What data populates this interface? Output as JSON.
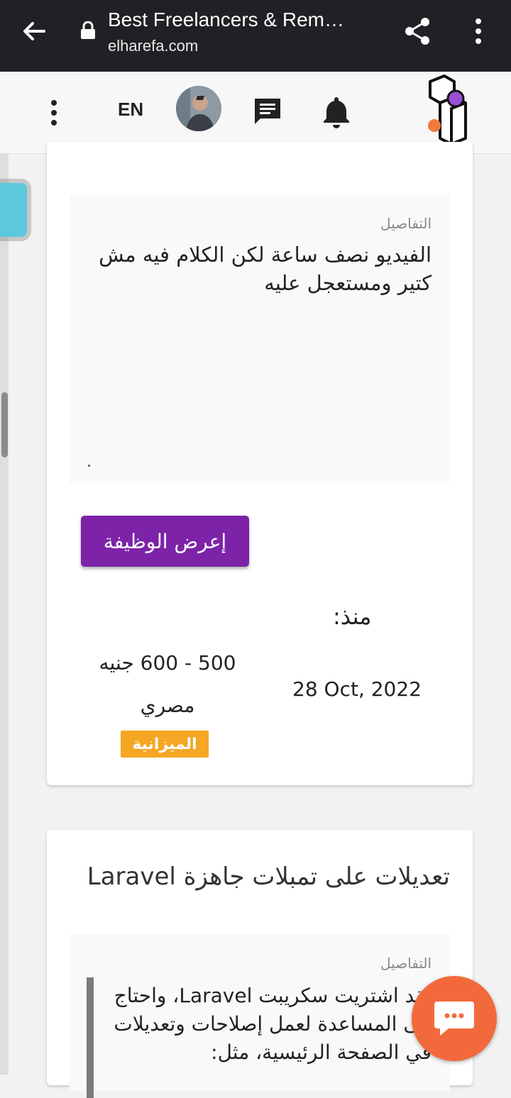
{
  "browser": {
    "title": "Best Freelancers & Rem…",
    "url": "elharefa.com"
  },
  "header": {
    "lang": "EN"
  },
  "card1": {
    "details_label": "التفاصيل",
    "details_text": "الفيديو نصف ساعة لكن الكلام فيه مش كتير ومستعجل عليه",
    "offer_button": "إعرض الوظيفة",
    "since_label": "منذ:",
    "since_date": "28 Oct, 2022",
    "budget_value": "500 - 600 جنيه مصري",
    "budget_label": "الميزانية"
  },
  "card2": {
    "title": "تعديلات على تمبلات جاهزة Laravel",
    "details_label": "التفاصيل",
    "details_text": "لقد اشتريت سكريبت Laravel، واحتاج الى المساعدة لعمل إصلاحات وتعديلات في الصفحة الرئيسية، مثل:"
  },
  "colors": {
    "offer_button": "#7c23a8",
    "budget_badge": "#f5a623",
    "chat_fab": "#f26a3c",
    "browser_bar": "#202124"
  },
  "icons": [
    "back-arrow-icon",
    "lock-icon",
    "share-icon",
    "more-vert-icon",
    "chat-icon",
    "bell-icon",
    "logo",
    "chat-bubble-icon"
  ]
}
